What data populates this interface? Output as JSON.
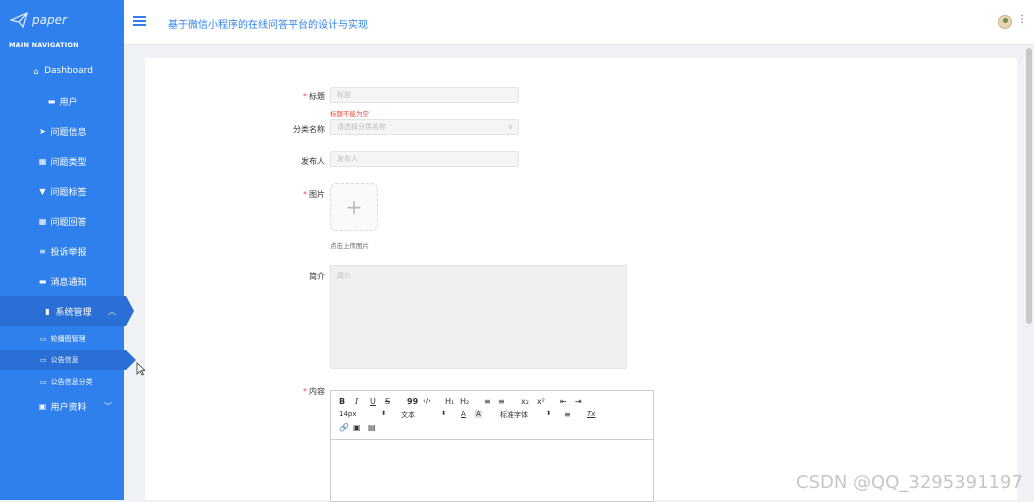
{
  "sidebar": {
    "logo": "paper",
    "nav_header": "MAIN NAVIGATION",
    "items": [
      {
        "label": "Dashboard",
        "icon": "home-icon"
      },
      {
        "label": "用户",
        "icon": "message-icon"
      },
      {
        "label": "问题信息",
        "icon": "send-icon"
      },
      {
        "label": "问题类型",
        "icon": "grid-icon"
      },
      {
        "label": "问题标签",
        "icon": "tag-icon"
      },
      {
        "label": "问题回答",
        "icon": "grid-icon"
      },
      {
        "label": "投诉举报",
        "icon": "list-icon"
      },
      {
        "label": "消息通知",
        "icon": "message-icon"
      },
      {
        "label": "系统管理",
        "icon": "trash-icon"
      },
      {
        "label": "用户资料",
        "icon": "calendar-icon"
      }
    ],
    "sub_items": [
      {
        "label": "轮播图管理",
        "icon": "folder-icon"
      },
      {
        "label": "公告信息",
        "icon": "folder-icon"
      },
      {
        "label": "公告信息分类",
        "icon": "folder-icon"
      }
    ]
  },
  "header": {
    "title": "基于微信小程序的在线问答平台的设计与实现"
  },
  "form": {
    "title_label": "标题",
    "title_placeholder": "标题",
    "title_error": "标题不能为空",
    "category_label": "分类名称",
    "category_placeholder": "请选择分类名称",
    "publisher_label": "发布人",
    "publisher_placeholder": "发布人",
    "image_label": "图片",
    "upload_plus": "+",
    "upload_hint": "点击上传图片",
    "intro_label": "简介",
    "intro_placeholder": "简介",
    "content_label": "内容"
  },
  "editor": {
    "bold": "B",
    "italic": "I",
    "underline": "U",
    "strike": "S",
    "quote": "99",
    "code": "‹/›",
    "h1": "H₁",
    "h2": "H₂",
    "ordered_list": "≡",
    "bullet_list": "≡",
    "subscript": "x₂",
    "superscript": "x²",
    "outdent": "⇤",
    "indent": "⇥",
    "font_size": "14px",
    "text_style": "文本",
    "font_family": "标准字体",
    "font_color": "A",
    "bg_color": "A",
    "align": "≡",
    "clear_format": "Tx"
  },
  "watermark": "CSDN @QQ_3295391197"
}
